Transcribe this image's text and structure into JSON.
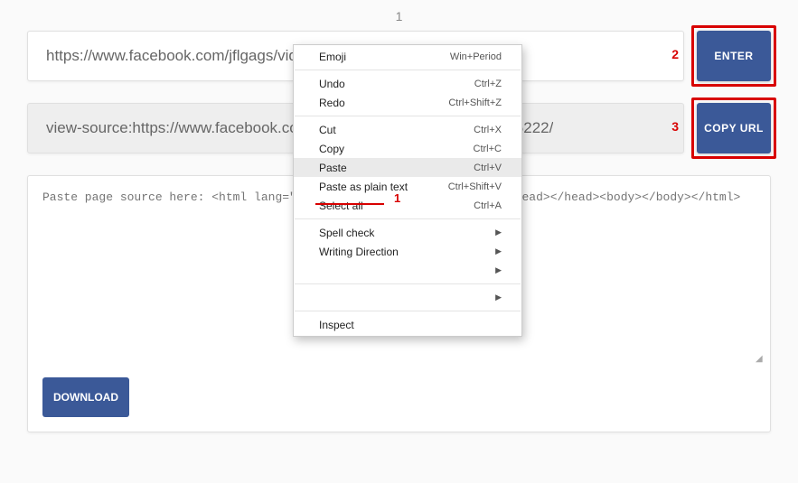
{
  "stepLabel1": "1",
  "urlInput": {
    "value": "https://www.facebook.com/jflgags/videos/1012386239535222/"
  },
  "enterButton": "ENTER",
  "sourceInput": {
    "value": "view-source:https://www.facebook.com/jflgags/videos/1012386239535222/"
  },
  "copyButton": "COPY URL",
  "textarea": {
    "placeholder": "Paste page source here: <html lang=\"en\" id=\"facebook\" class=\"...\"><head></head><body></body></html>"
  },
  "downloadButton": "DOWNLOAD",
  "annotations": {
    "num1": "1",
    "num2": "2",
    "num3": "3"
  },
  "contextMenu": {
    "emoji": {
      "label": "Emoji",
      "shortcut": "Win+Period"
    },
    "undo": {
      "label": "Undo",
      "shortcut": "Ctrl+Z"
    },
    "redo": {
      "label": "Redo",
      "shortcut": "Ctrl+Shift+Z"
    },
    "cut": {
      "label": "Cut",
      "shortcut": "Ctrl+X"
    },
    "copy": {
      "label": "Copy",
      "shortcut": "Ctrl+C"
    },
    "paste": {
      "label": "Paste",
      "shortcut": "Ctrl+V"
    },
    "pastePlain": {
      "label": "Paste as plain text",
      "shortcut": "Ctrl+Shift+V"
    },
    "selectAll": {
      "label": "Select all",
      "shortcut": "Ctrl+A"
    },
    "spellCheck": {
      "label": "Spell check"
    },
    "writingDirection": {
      "label": "Writing Direction"
    },
    "inspect": {
      "label": "Inspect"
    }
  }
}
